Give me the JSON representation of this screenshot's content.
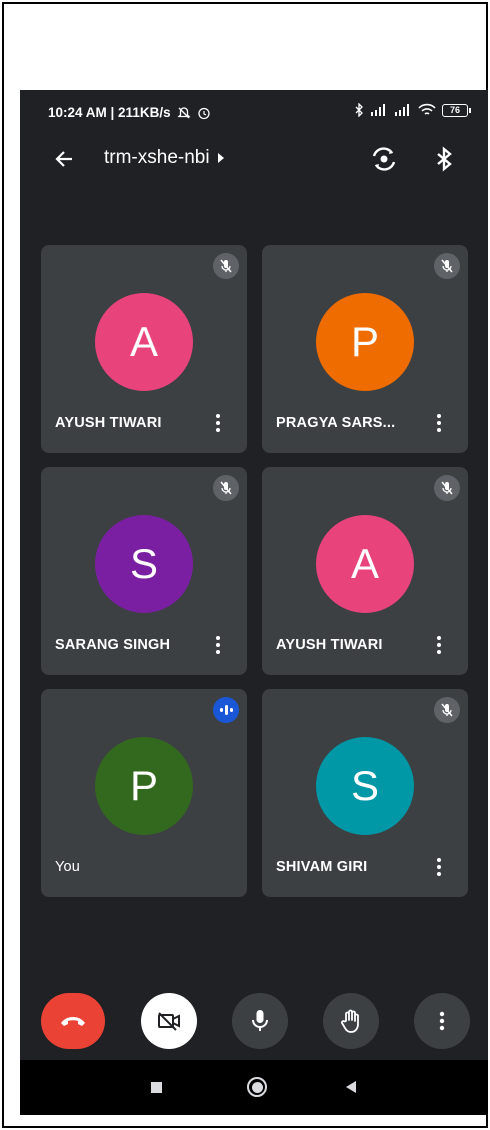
{
  "status_bar": {
    "time_speed": "10:24 AM | 211KB/s",
    "battery": "76"
  },
  "app_bar": {
    "meeting_code": "trm-xshe-nbi",
    "back_icon": "arrow-back-icon",
    "camera_switch_icon": "camera-switch-icon",
    "bluetooth_icon": "bluetooth-icon"
  },
  "participants": [
    {
      "initial": "A",
      "name": "AYUSH TIWARI",
      "color": "#e8437a",
      "muted": true
    },
    {
      "initial": "P",
      "name": "PRAGYA SARS...",
      "color": "#ef6c00",
      "muted": true
    },
    {
      "initial": "S",
      "name": "SARANG SINGH",
      "color": "#7b1fa2",
      "muted": true
    },
    {
      "initial": "A",
      "name": "AYUSH TIWARI",
      "color": "#e8437a",
      "muted": true
    },
    {
      "initial": "P",
      "name": "You",
      "color": "#33691e",
      "muted": false,
      "speaking": true
    },
    {
      "initial": "S",
      "name": "SHIVAM GIRI",
      "color": "#0097a7",
      "muted": true
    }
  ],
  "controls": {
    "hangup_icon": "hang-up-icon",
    "video_icon": "video-off-icon",
    "mic_icon": "mic-icon",
    "hand_icon": "raise-hand-icon",
    "more_icon": "more-vert-icon"
  },
  "colors": {
    "background": "#202124",
    "tile": "#3c4043",
    "hangup": "#ea4335",
    "speaking": "#1a57d6"
  }
}
